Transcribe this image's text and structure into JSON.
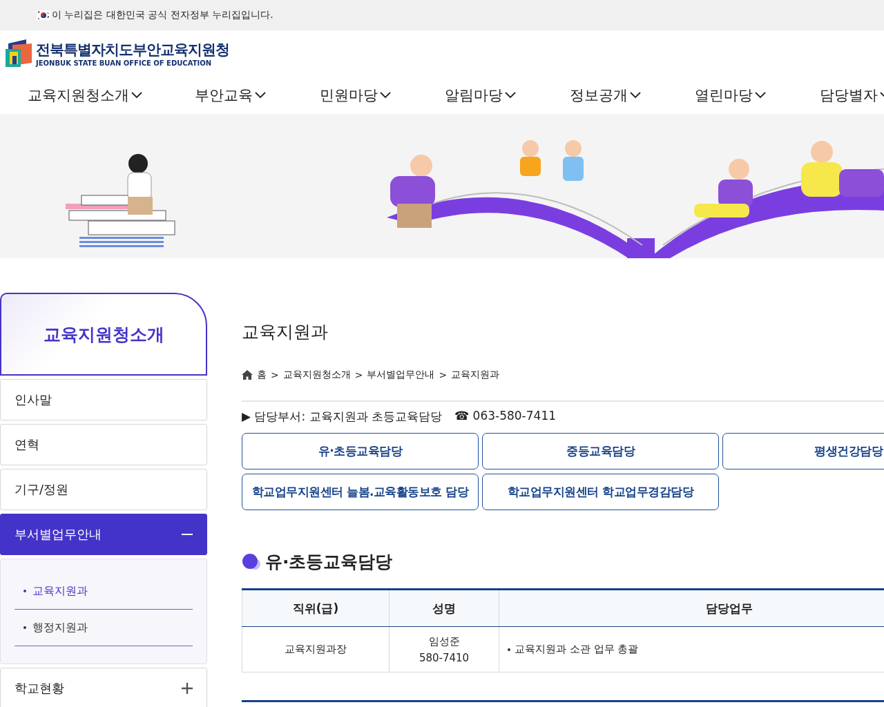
{
  "gov_banner": {
    "text": "이 누리집은 대한민국 공식 전자정부 누리집입니다."
  },
  "logo": {
    "name_ko": "전북특별자치도부안교육지원청",
    "name_en": "JEONBUK STATE BUAN OFFICE OF EDUCATION"
  },
  "nav": [
    {
      "label": "교육지원청소개"
    },
    {
      "label": "부안교육"
    },
    {
      "label": "민원마당"
    },
    {
      "label": "알림마당"
    },
    {
      "label": "정보공개"
    },
    {
      "label": "열린마당"
    },
    {
      "label": "담당별자"
    }
  ],
  "sidebar": {
    "title": "교육지원청소개",
    "items": [
      {
        "kind": "link",
        "label": "인사말",
        "selected": false
      },
      {
        "kind": "link",
        "label": "연혁",
        "selected": false
      },
      {
        "kind": "link",
        "label": "기구/정원",
        "selected": false
      },
      {
        "kind": "group",
        "label": "부서별업무안내",
        "selected": true,
        "expanded": true,
        "children": [
          {
            "label": "교육지원과",
            "selected": true
          },
          {
            "label": "행정지원과",
            "selected": false
          }
        ]
      },
      {
        "kind": "group",
        "label": "학교현황",
        "selected": false,
        "expanded": false
      }
    ]
  },
  "content": {
    "title": "교육지원과",
    "breadcrumb": [
      "홈",
      "교육지원청소개",
      "부서별업무안내",
      "교육지원과"
    ],
    "breadcrumb_separator": ">",
    "department": {
      "label": "▶ 담당부서: 교육지원과 초등교육담당",
      "phone": "☎ 063-580-7411"
    },
    "team_buttons": [
      "유·초등교육담당",
      "중등교육담당",
      "평생건강담당",
      "학교업무지원센터 늘봄.교육활동보호 담당",
      "학교업무지원센터 학교업무경감담당"
    ],
    "section_title": "유·초등교육담당",
    "table": {
      "columns": [
        "직위(급)",
        "성명",
        "담당업무"
      ],
      "rows": [
        {
          "position": "교육지원과장",
          "name": "임성준",
          "phone": "580-7410",
          "duties": "교육지원과 소관 업무 총괄"
        }
      ]
    }
  }
}
